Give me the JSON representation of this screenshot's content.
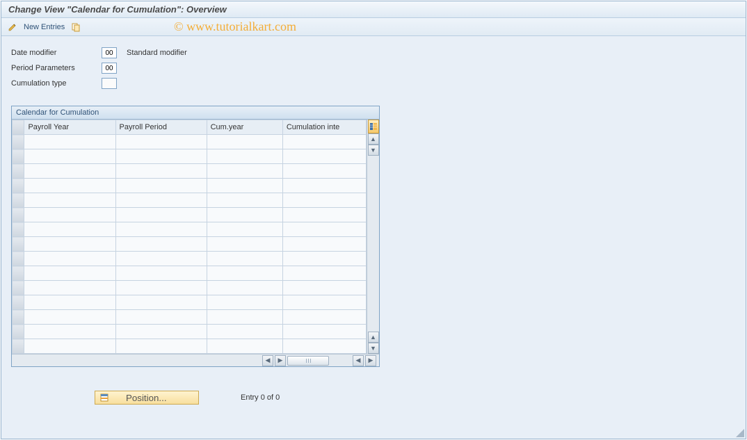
{
  "title": "Change View \"Calendar for Cumulation\": Overview",
  "toolbar": {
    "new_entries_label": "New Entries"
  },
  "watermark": "© www.tutorialkart.com",
  "fields": {
    "date_modifier": {
      "label": "Date modifier",
      "value": "00",
      "desc": "Standard modifier"
    },
    "period_params": {
      "label": "Period Parameters",
      "value": "00"
    },
    "cumulation_type": {
      "label": "Cumulation type",
      "value": ""
    }
  },
  "panel": {
    "title": "Calendar for Cumulation",
    "columns": [
      "Payroll Year",
      "Payroll Period",
      "Cum.year",
      "Cumulation inte"
    ],
    "row_count": 15
  },
  "footer": {
    "position_label": "Position...",
    "entry_text": "Entry 0 of 0"
  }
}
